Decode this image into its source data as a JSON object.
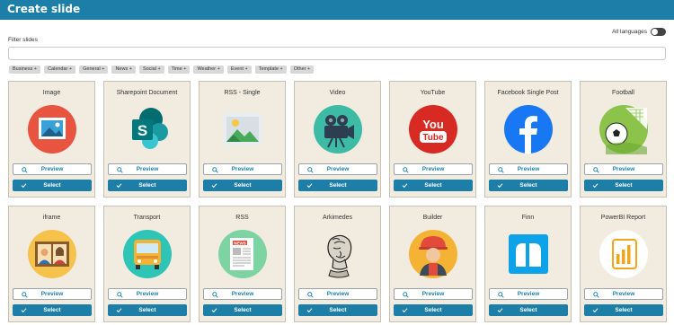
{
  "header": {
    "title": "Create slide"
  },
  "language_toggle": {
    "label": "All languages"
  },
  "filter": {
    "label": "Filter slides",
    "value": "",
    "placeholder": ""
  },
  "tags": [
    "Business +",
    "Calendar +",
    "General +",
    "News +",
    "Social +",
    "Time +",
    "Weather +",
    "Event +",
    "Template +",
    "Other +"
  ],
  "buttons": {
    "preview": "Preview",
    "select": "Select"
  },
  "slides": [
    {
      "title": "Image",
      "icon": "image-icon"
    },
    {
      "title": "Sharepoint Document",
      "icon": "sharepoint-icon"
    },
    {
      "title": "RSS - Single",
      "icon": "rss-single-icon"
    },
    {
      "title": "Video",
      "icon": "video-camera-icon"
    },
    {
      "title": "YouTube",
      "icon": "youtube-icon"
    },
    {
      "title": "Facebook Single Post",
      "icon": "facebook-icon"
    },
    {
      "title": "Football",
      "icon": "football-icon"
    },
    {
      "title": "iframe",
      "icon": "iframe-icon"
    },
    {
      "title": "Transport",
      "icon": "bus-icon"
    },
    {
      "title": "RSS",
      "icon": "newspaper-icon"
    },
    {
      "title": "Arkimedes",
      "icon": "arkimedes-bust-icon"
    },
    {
      "title": "Builder",
      "icon": "builder-icon"
    },
    {
      "title": "Finn",
      "icon": "finn-icon"
    },
    {
      "title": "PowerBI Report",
      "icon": "powerbi-icon"
    }
  ],
  "colors": {
    "primary": "#1d7fa8",
    "card_bg": "#f2ece0",
    "tag_bg": "#d8d8d8"
  }
}
